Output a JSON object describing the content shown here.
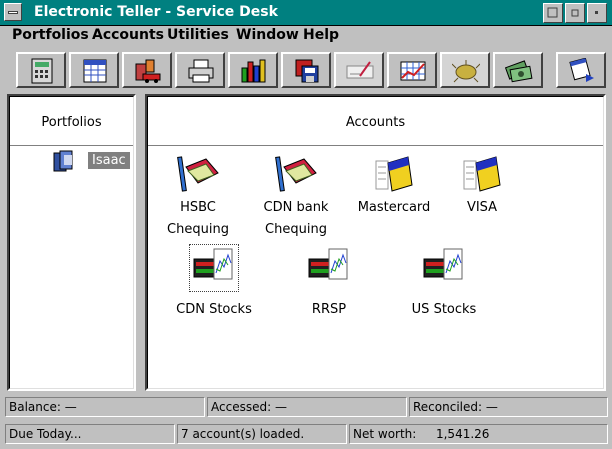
{
  "window": {
    "title": "Electronic Teller - Service Desk"
  },
  "menu": [
    {
      "label": "Portfolios"
    },
    {
      "label": "Accounts"
    },
    {
      "label": "Utilities"
    },
    {
      "label": "Window"
    },
    {
      "label": "Help"
    }
  ],
  "toolbar": [
    {
      "icon": "calculator-icon"
    },
    {
      "icon": "calendar-icon"
    },
    {
      "icon": "car-house-icon"
    },
    {
      "icon": "printer-icon"
    },
    {
      "icon": "bar-chart-icon"
    },
    {
      "icon": "disk-icon"
    },
    {
      "icon": "cheque-icon"
    },
    {
      "icon": "grid-chart-icon"
    },
    {
      "icon": "bug-icon"
    },
    {
      "icon": "money-icon"
    },
    {
      "icon": "calendar-arrow-icon"
    }
  ],
  "portfolios": {
    "header": "Portfolios",
    "items": [
      {
        "label": "Isaac"
      }
    ]
  },
  "accounts": {
    "header": "Accounts",
    "items": [
      {
        "line1": "HSBC",
        "line2": "Chequing",
        "icon": "chequebook-icon"
      },
      {
        "line1": "CDN bank",
        "line2": "Chequing",
        "icon": "chequebook-icon"
      },
      {
        "line1": "Mastercard",
        "line2": "",
        "icon": "credit-card-icon"
      },
      {
        "line1": "VISA",
        "line2": "",
        "icon": "credit-card-icon"
      },
      {
        "line1": "CDN Stocks",
        "line2": "",
        "icon": "stock-ticker-icon"
      },
      {
        "line1": "RRSP",
        "line2": "",
        "icon": "stock-ticker-icon"
      },
      {
        "line1": "US Stocks",
        "line2": "",
        "icon": "stock-ticker-icon"
      }
    ]
  },
  "status": {
    "balance": "Balance: —",
    "accessed": "Accessed: —",
    "reconciled": "Reconciled: —",
    "due": "Due Today...",
    "loaded": "7 account(s) loaded.",
    "networth_label": "Net worth:",
    "networth_value": "1,541.26"
  }
}
